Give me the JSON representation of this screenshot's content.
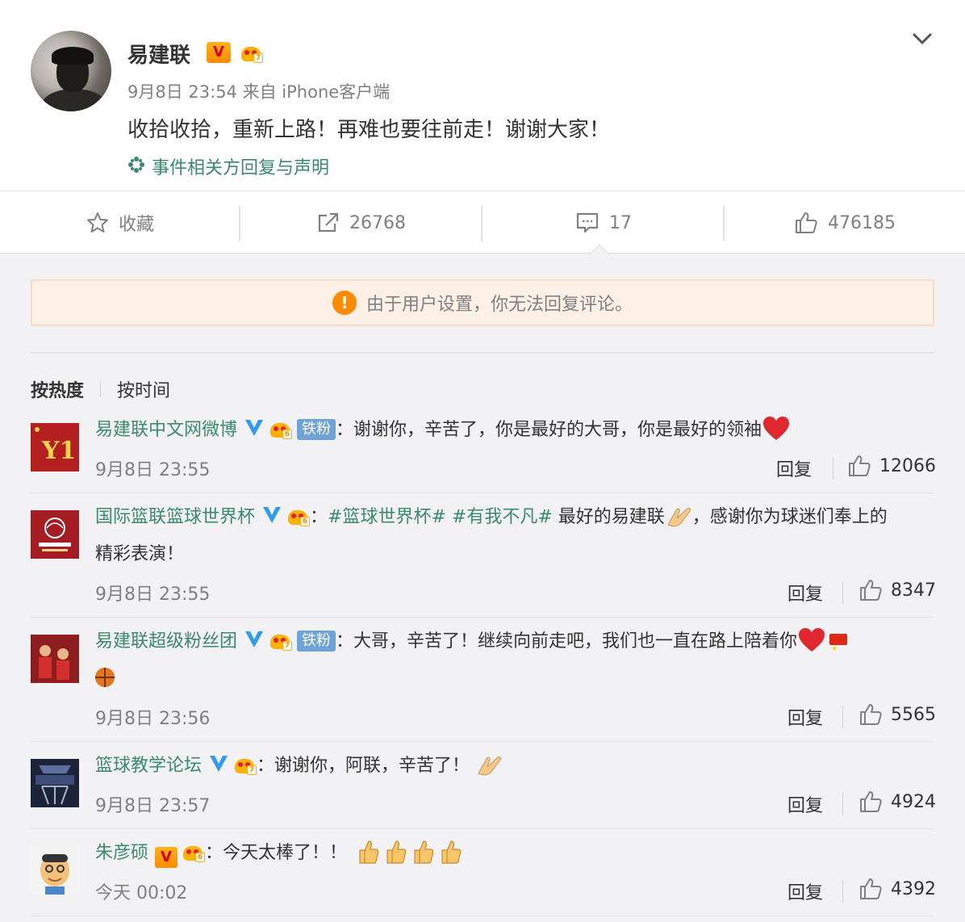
{
  "post": {
    "author": "易建联",
    "author_badge": "V",
    "crown_level": "7",
    "time": "9月8日 23:54",
    "source": "来自 iPhone客户端",
    "text": "收拾收拾，重新上路！再难也要往前走！谢谢大家！",
    "topic_link": "事件相关方回复与声明"
  },
  "actions": {
    "favorite": "收藏",
    "repost_count": "26768",
    "comment_count": "17",
    "like_count": "476185"
  },
  "notice": "由于用户设置，你无法回复评论。",
  "sort": {
    "hot": "按热度",
    "time": "按时间"
  },
  "comments": [
    {
      "name": "易建联中文网微博",
      "crown_level": "6",
      "fan_badge": "铁粉",
      "colon": "：",
      "text": "谢谢你，辛苦了，你是最好的大哥，你是最好的领袖",
      "time": "9月8日 23:55",
      "reply": "回复",
      "likes": "12066"
    },
    {
      "name": "国际篮联篮球世界杯",
      "crown_level": "6",
      "colon": "：",
      "topic1": "#篮球世界杯#",
      "topic2": "#有我不凡#",
      "text_a": "最好的易建联",
      "text_b": "，感谢你为球迷们奉上的",
      "text_c": "精彩表演！",
      "time": "9月8日 23:55",
      "reply": "回复",
      "likes": "8347"
    },
    {
      "name": "易建联超级粉丝团",
      "crown_level": "7",
      "fan_badge": "铁粉",
      "colon": "：",
      "text": "大哥，辛苦了！继续向前走吧，我们也一直在路上陪着你",
      "time": "9月8日 23:56",
      "reply": "回复",
      "likes": "5565"
    },
    {
      "name": "篮球教学论坛",
      "crown_level": "7",
      "colon": "：",
      "text": "谢谢你，阿联，辛苦了！",
      "time": "9月8日 23:57",
      "reply": "回复",
      "likes": "4924"
    },
    {
      "name": "朱彦硕",
      "badge": "V",
      "crown_level": "6",
      "colon": "：",
      "text": "今天太棒了！！",
      "time": "今天 00:02",
      "reply": "回复",
      "likes": "4392"
    }
  ],
  "colors": {
    "link_green": "#3a8a6b",
    "muted": "#808080",
    "accent_orange": "#ff8a00",
    "verified_blue": "#2e9cf0",
    "notice_bg": "#fdf1e7"
  }
}
